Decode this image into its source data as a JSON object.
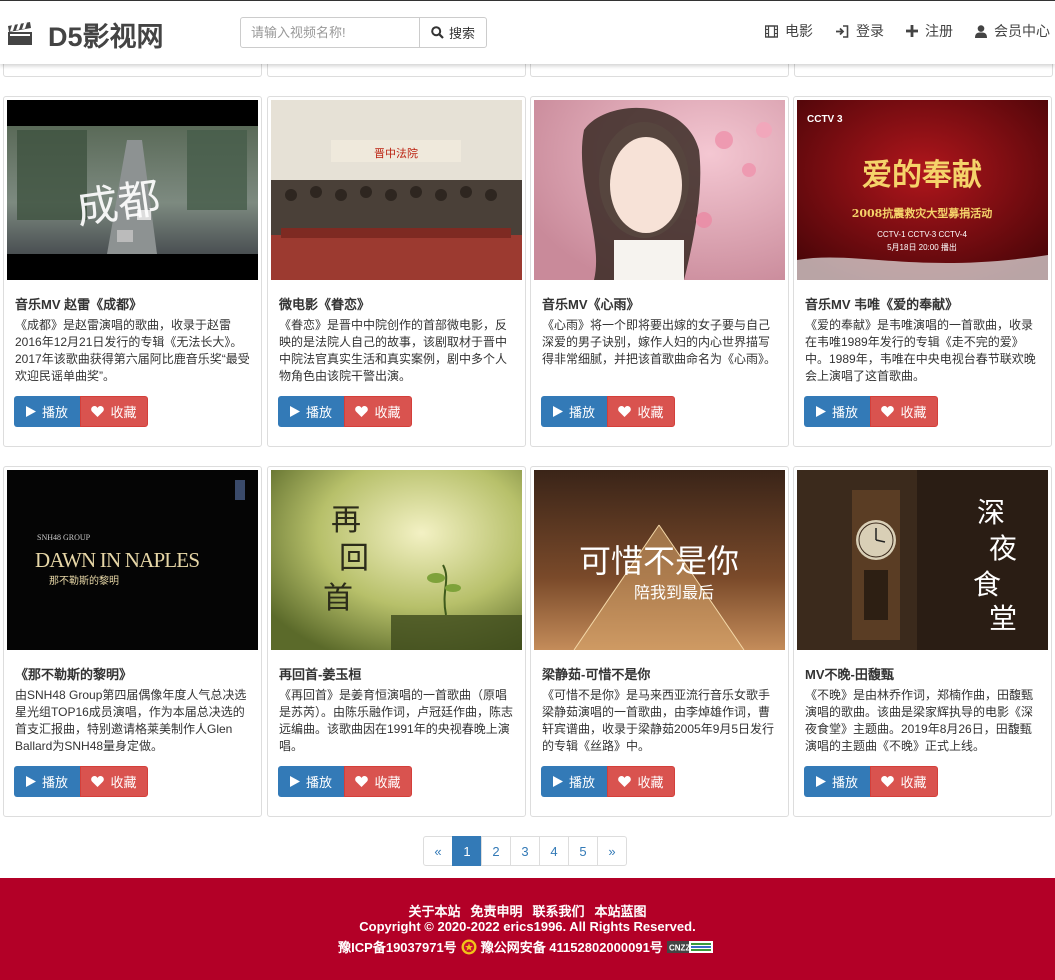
{
  "brand": {
    "name": "D5影视网"
  },
  "search": {
    "placeholder": "请输入视频名称!",
    "button_label": "搜索"
  },
  "nav": [
    {
      "label": "电影",
      "icon": "film-icon"
    },
    {
      "label": "登录",
      "icon": "login-icon"
    },
    {
      "label": "注册",
      "icon": "plus-icon"
    },
    {
      "label": "会员中心",
      "icon": "user-icon"
    }
  ],
  "buttons": {
    "play": "播放",
    "favorite": "收藏"
  },
  "cards": [
    {
      "title": "音乐MV 赵雷《成都》",
      "desc": "《成都》是赵雷演唱的歌曲，收录于赵雷2016年12月21日发行的专辑《无法长大》。2017年该歌曲获得第六届阿比鹿音乐奖“最受欢迎民谣单曲奖”。",
      "thumb_text": "成都"
    },
    {
      "title": "微电影《眷恋》",
      "desc": "《眷恋》是晋中中院创作的首部微电影，反映的是法院人自己的故事，该剧取材于晋中中院法官真实生活和真实案例，剧中多个人物角色由该院干警出演。",
      "thumb_text": "晋中法院"
    },
    {
      "title": "音乐MV《心雨》",
      "desc": "《心雨》将一个即将要出嫁的女子要与自己深爱的男子诀别，嫁作人妇的内心世界描写得非常细腻，并把该首歌曲命名为《心雨》。",
      "thumb_text": ""
    },
    {
      "title": "音乐MV 韦唯《爱的奉献》",
      "desc": "《爱的奉献》是韦唯演唱的一首歌曲，收录在韦唯1989年发行的专辑《走不完的爱》中。1989年，韦唯在中央电视台春节联欢晚会上演唱了这首歌曲。",
      "thumb_text": "爱的奉献",
      "thumb_sub": "2008抗震救灾大型募捐活动",
      "thumb_channels": "CCTV-1   CCTV-3   CCTV-4",
      "thumb_date": "5月18日  20:00  播出",
      "thumb_logo": "CCTV 3"
    },
    {
      "title": "《那不勒斯的黎明》",
      "desc": "由SNH48 Group第四届偶像年度人气总决选星光组TOP16成员演唱，作为本届总决选的首支汇报曲，特别邀请格莱美制作人Glen Ballard为SNH48量身定做。",
      "thumb_text": "DAWN IN NAPLES",
      "thumb_sub": "那不勒斯的黎明",
      "thumb_logo": "SNH48 GROUP"
    },
    {
      "title": "再回首-姜玉桓",
      "desc": "《再回首》是姜育恒演唱的一首歌曲（原唱是苏芮）。由陈乐融作词，卢冠廷作曲，陈志远编曲。该歌曲因在1991年的央视春晚上演唱。",
      "thumb_text": "再回首"
    },
    {
      "title": "梁静茹-可惜不是你",
      "desc": "《可惜不是你》是马来西亚流行音乐女歌手梁静茹演唱的一首歌曲，由李焯雄作词，曹轩宾谱曲，收录于梁静茹2005年9月5日发行的专辑《丝路》中。",
      "thumb_text": "可惜不是你",
      "thumb_sub": "陪我到最后"
    },
    {
      "title": "MV不晚-田馥甄",
      "desc": "《不晚》是由林乔作词，郑楠作曲，田馥甄演唱的歌曲。该曲是梁家辉执导的电影《深夜食堂》主题曲。2019年8月26日，田馥甄演唱的主题曲《不晚》正式上线。",
      "thumb_text": "深夜食堂"
    }
  ],
  "pagination": [
    "«",
    "1",
    "2",
    "3",
    "4",
    "5",
    "»"
  ],
  "pagination_active": "1",
  "footer": {
    "links": [
      "关于本站",
      "免责申明",
      "联系我们",
      "本站蓝图"
    ],
    "copyright": "Copyright © 2020-2022  erics1996. All Rights Reserved.",
    "icp": "豫ICP备19037971号",
    "police": "豫公网安备 41152802000091号"
  },
  "colors": {
    "primary": "#337ab7",
    "danger": "#d9534f",
    "footer": "#b30027"
  }
}
